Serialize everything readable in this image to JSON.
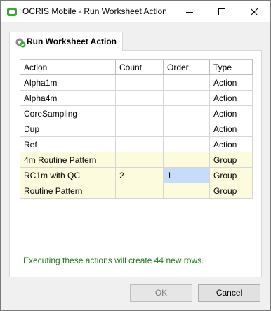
{
  "window": {
    "title": "OCRIS Mobile - Run Worksheet Action",
    "app_icon": "ocris-app-icon",
    "controls": [
      "minimize-icon",
      "maximize-icon",
      "close-icon"
    ]
  },
  "tab": {
    "label": "Run Worksheet Action",
    "icon": "worksheet-action-icon"
  },
  "table": {
    "columns": [
      "Action",
      "Count",
      "Order",
      "Type"
    ],
    "rows": [
      {
        "action": "Alpha1m",
        "count": "",
        "order": "",
        "type": "Action"
      },
      {
        "action": "Alpha4m",
        "count": "",
        "order": "",
        "type": "Action"
      },
      {
        "action": "CoreSampling",
        "count": "",
        "order": "",
        "type": "Action"
      },
      {
        "action": "Dup",
        "count": "",
        "order": "",
        "type": "Action"
      },
      {
        "action": "Ref",
        "count": "",
        "order": "",
        "type": "Action"
      },
      {
        "action": "4m Routine Pattern",
        "count": "",
        "order": "",
        "type": "Group"
      },
      {
        "action": "RC1m with QC",
        "count": "2",
        "order": "1",
        "type": "Group"
      },
      {
        "action": "Routine Pattern",
        "count": "",
        "order": "",
        "type": "Group"
      }
    ]
  },
  "status_message": "Executing these actions will create 44 new rows.",
  "buttons": {
    "ok": "OK",
    "cancel": "Cancel"
  },
  "colors": {
    "group_row_background": "#fdfbdd",
    "selected_cell": "#c5dcfb",
    "status_text": "#217c1e",
    "app_icon_green": "#3aa635"
  }
}
